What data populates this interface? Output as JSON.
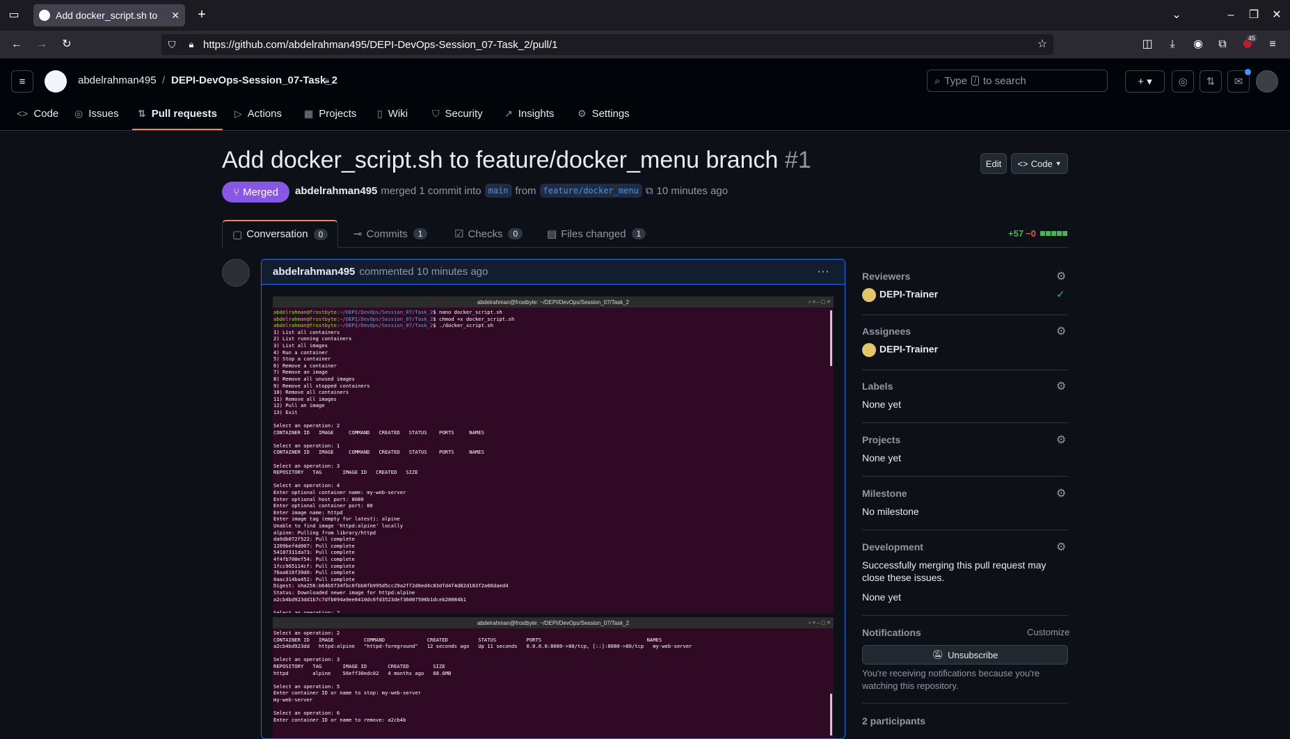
{
  "browser": {
    "tab_title": "Add docker_script.sh to",
    "url": "https://github.com/abdelrahman495/DEPI-DevOps-Session_07-Task_2/pull/1",
    "badge_count": "45"
  },
  "header": {
    "owner": "abdelrahman495",
    "separator": "/",
    "repo": "DEPI-DevOps-Session_07-Task_2",
    "search_placeholder_pre": "Type",
    "search_key": "/",
    "search_placeholder_post": "to search"
  },
  "repo_nav": [
    {
      "label": "Code",
      "icon": "<>"
    },
    {
      "label": "Issues",
      "icon": "◎"
    },
    {
      "label": "Pull requests",
      "icon": "⇅"
    },
    {
      "label": "Actions",
      "icon": "▷"
    },
    {
      "label": "Projects",
      "icon": "▦"
    },
    {
      "label": "Wiki",
      "icon": "▯"
    },
    {
      "label": "Security",
      "icon": "⛉"
    },
    {
      "label": "Insights",
      "icon": "↗"
    },
    {
      "label": "Settings",
      "icon": "⚙"
    }
  ],
  "pr": {
    "title": "Add docker_script.sh to feature/docker_menu branch",
    "number": "#1",
    "state": "Merged",
    "author": "abdelrahman495",
    "merged_text": "merged 1 commit into",
    "base_branch": "main",
    "from_text": "from",
    "head_branch": "feature/docker_menu",
    "time": "10 minutes ago",
    "edit_label": "Edit",
    "code_label": "Code"
  },
  "pr_tabs": [
    {
      "label": "Conversation",
      "count": "0"
    },
    {
      "label": "Commits",
      "count": "1"
    },
    {
      "label": "Checks",
      "count": "0"
    },
    {
      "label": "Files changed",
      "count": "1"
    }
  ],
  "diffstat": {
    "added": "+57",
    "removed": "−0"
  },
  "comment": {
    "author": "abdelrahman495",
    "meta": "commented 10 minutes ago"
  },
  "terminal1": {
    "title": "abdelrahman@frostbyte: ~/DEPI/DevOps/Session_07/Task_2",
    "prompt_user": "abdelrahman@frostbyte:",
    "prompt_dir": "~/DEPI/DevOps/Session_07/Task_2",
    "cmds": [
      "$ nano docker_script.sh",
      "$ chmod +x docker_script.sh",
      "$ ./docker_script.sh"
    ],
    "body": "1) List all containers\n2) List running containers\n3) List all images\n4) Run a container\n5) Stop a container\n6) Remove a container\n7) Remove an image\n8) Remove all unused images\n9) Remove all stopped containers\n10) Remove all containers\n11) Remove all images\n12) Pull an image\n13) Exit\n\nSelect an operation: 2\nCONTAINER ID   IMAGE     COMMAND   CREATED   STATUS    PORTS     NAMES\n\nSelect an operation: 1\nCONTAINER ID   IMAGE     COMMAND   CREATED   STATUS    PORTS     NAMES\n\nSelect an operation: 3\nREPOSITORY   TAG       IMAGE ID   CREATED   SIZE\n\nSelect an operation: 4\nEnter optional container name: my-web-server\nEnter optional host port: 8080\nEnter optional container port: 80\nEnter image name: httpd\nEnter image tag (empty for latest): alpine\nUnable to find image 'httpd:alpine' locally\nalpine: Pulling from library/httpd\nda9db072f522: Pull complete\n1209bef4d007: Pull complete\n54187311da73: Pull complete\n4f4fb700ef54: Pull complete\n1fcc965114cf: Pull complete\n76aa616f39d0: Pull complete\n0aac314ba452: Pull complete\nDigest: sha256:b64b5734fbc0fbb8fb995d5cc29a2ff2d6ed4c83dfd4f4d82d183f2a66daed4\nStatus: Downloaded newer image for httpd:alpine\na2cb4bd923dd1b7c7dfb094a9ee6410dc6fd3523def36007506b1dceb28084b1\n\nSelect an operation: 2"
  },
  "terminal2": {
    "title": "abdelrahman@frostbyte: ~/DEPI/DevOps/Session_07/Task_2",
    "body": "Select an operation: 2\nCONTAINER ID   IMAGE          COMMAND              CREATED          STATUS          PORTS                                   NAMES\na2cb4bd923dd   httpd:alpine   \"httpd-foreground\"   12 seconds ago   Up 11 seconds   0.0.0.0:8080->80/tcp, [::]:8080->80/tcp   my-web-server\n\nSelect an operation: 3\nREPOSITORY   TAG       IMAGE ID       CREATED        SIZE\nhttpd        alpine    56eff30edc02   4 months ago   68.6MB\n\nSelect an operation: 5\nEnter container ID or name to stop: my-web-server\nmy-web-server\n\nSelect an operation: 6\nEnter container ID or name to remove: a2cb4b"
  },
  "sidebar": {
    "reviewers_label": "Reviewers",
    "reviewer": "DEPI-Trainer",
    "assignees_label": "Assignees",
    "assignee": "DEPI-Trainer",
    "labels_label": "Labels",
    "labels_value": "None yet",
    "projects_label": "Projects",
    "projects_value": "None yet",
    "milestone_label": "Milestone",
    "milestone_value": "No milestone",
    "development_label": "Development",
    "development_text": "Successfully merging this pull request may close these issues.",
    "development_value": "None yet",
    "notifications_label": "Notifications",
    "customize_label": "Customize",
    "unsubscribe_label": "Unsubscribe",
    "notifications_text": "You're receiving notifications because you're watching this repository.",
    "participants": "2 participants"
  },
  "colors": {
    "merged": "#8957e5",
    "accent_link": "#4493f8",
    "added": "#3fb950",
    "removed": "#f85149",
    "terminal_bg": "#300a24"
  }
}
